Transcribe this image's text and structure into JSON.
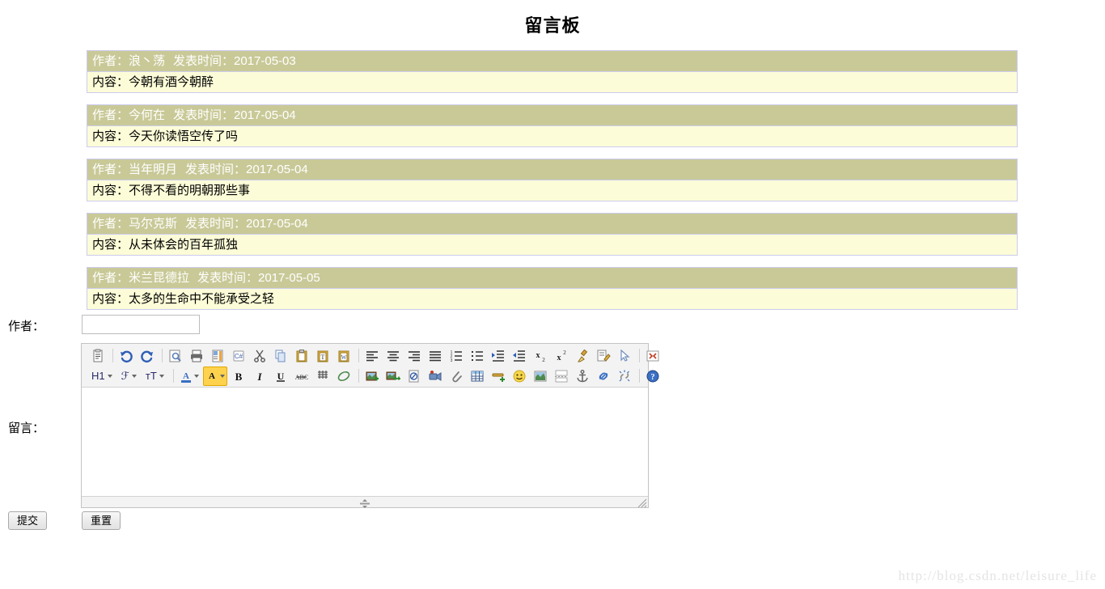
{
  "page": {
    "title": "留言板",
    "watermark": "http://blog.csdn.net/leisure_life"
  },
  "colors": {
    "header_bg": "#c9c998",
    "header_text": "#ffffff",
    "body_bg": "#fcfcd8",
    "body_text": "#000000",
    "row_border": "#ccccee",
    "toolbar_bg": "#f3f3f3",
    "watermark_text": "#e4e4e4"
  },
  "messages": {
    "author_prefix": "作者：",
    "time_prefix": "发表时间：",
    "content_prefix": "内容：",
    "items": [
      {
        "author": "浪丶荡",
        "time": "2017-05-03",
        "content": "今朝有酒今朝醉"
      },
      {
        "author": "今何在",
        "time": "2017-05-04",
        "content": "今天你读悟空传了吗"
      },
      {
        "author": "当年明月",
        "time": "2017-05-04",
        "content": "不得不看的明朝那些事"
      },
      {
        "author": "马尔克斯",
        "time": "2017-05-04",
        "content": "从未体会的百年孤独"
      },
      {
        "author": "米兰昆德拉",
        "time": "2017-05-05",
        "content": "太多的生命中不能承受之轻"
      }
    ]
  },
  "form": {
    "author_label": "作者：",
    "author_value": "",
    "author_placeholder": "",
    "message_label": "留言：",
    "message_value": "",
    "submit_label": "提交",
    "reset_label": "重置"
  },
  "editor": {
    "toolbar_row1": [
      {
        "name": "source-icon",
        "glyph": "source"
      },
      {
        "name": "separator",
        "glyph": "sep"
      },
      {
        "name": "undo-icon",
        "glyph": "undo"
      },
      {
        "name": "redo-icon",
        "glyph": "redo"
      },
      {
        "name": "separator",
        "glyph": "sep"
      },
      {
        "name": "preview-icon",
        "glyph": "preview"
      },
      {
        "name": "print-icon",
        "glyph": "print"
      },
      {
        "name": "templates-icon",
        "glyph": "templates"
      },
      {
        "name": "code-csharp-icon",
        "glyph": "csharp"
      },
      {
        "name": "cut-icon",
        "glyph": "cut"
      },
      {
        "name": "copy-icon",
        "glyph": "copy"
      },
      {
        "name": "paste-icon",
        "glyph": "paste"
      },
      {
        "name": "paste-text-icon",
        "glyph": "pastetext"
      },
      {
        "name": "paste-word-icon",
        "glyph": "pasteword"
      },
      {
        "name": "separator",
        "glyph": "sep"
      },
      {
        "name": "align-left-icon",
        "glyph": "alignleft"
      },
      {
        "name": "align-center-icon",
        "glyph": "aligncenter"
      },
      {
        "name": "align-right-icon",
        "glyph": "alignright"
      },
      {
        "name": "align-justify-icon",
        "glyph": "alignjustify"
      },
      {
        "name": "numbered-list-icon",
        "glyph": "numlist"
      },
      {
        "name": "bulleted-list-icon",
        "glyph": "bullist"
      },
      {
        "name": "indent-icon",
        "glyph": "indent"
      },
      {
        "name": "outdent-icon",
        "glyph": "outdent"
      },
      {
        "name": "subscript-icon",
        "glyph": "subscript"
      },
      {
        "name": "superscript-icon",
        "glyph": "superscript"
      },
      {
        "name": "remove-format-icon",
        "glyph": "brush"
      },
      {
        "name": "edit-document-icon",
        "glyph": "editdoc"
      },
      {
        "name": "select-cursor-icon",
        "glyph": "cursor"
      },
      {
        "name": "separator",
        "glyph": "sep"
      },
      {
        "name": "maximize-icon",
        "glyph": "maximize"
      }
    ],
    "toolbar_row2_combos": [
      {
        "name": "paragraph-format-select",
        "label": "H1"
      },
      {
        "name": "font-family-select",
        "label": "ℱ"
      },
      {
        "name": "font-size-select",
        "label": "ᴛT"
      }
    ],
    "toolbar_row2": [
      {
        "name": "text-color-icon",
        "glyph": "textcolor"
      },
      {
        "name": "background-color-icon",
        "glyph": "bgcolor"
      },
      {
        "name": "bold-icon",
        "glyph": "bold"
      },
      {
        "name": "italic-icon",
        "glyph": "italic"
      },
      {
        "name": "underline-icon",
        "glyph": "underline"
      },
      {
        "name": "strikethrough-icon",
        "glyph": "strike"
      },
      {
        "name": "line-height-icon",
        "glyph": "lineheight"
      },
      {
        "name": "eraser-icon",
        "glyph": "eraser"
      },
      {
        "name": "separator",
        "glyph": "sep"
      },
      {
        "name": "image-icon",
        "glyph": "image"
      },
      {
        "name": "multi-image-icon",
        "glyph": "multiimage"
      },
      {
        "name": "flash-icon",
        "glyph": "flash"
      },
      {
        "name": "video-icon",
        "glyph": "video"
      },
      {
        "name": "attachment-icon",
        "glyph": "attach"
      },
      {
        "name": "table-icon",
        "glyph": "table"
      },
      {
        "name": "horizontal-rule-icon",
        "glyph": "hr"
      },
      {
        "name": "emoji-icon",
        "glyph": "emoji"
      },
      {
        "name": "picture-icon",
        "glyph": "picture"
      },
      {
        "name": "page-break-icon",
        "glyph": "pagebreak"
      },
      {
        "name": "anchor-icon",
        "glyph": "anchor"
      },
      {
        "name": "link-icon",
        "glyph": "link"
      },
      {
        "name": "unlink-icon",
        "glyph": "unlink"
      },
      {
        "name": "separator",
        "glyph": "sep"
      },
      {
        "name": "help-icon",
        "glyph": "help"
      }
    ]
  }
}
